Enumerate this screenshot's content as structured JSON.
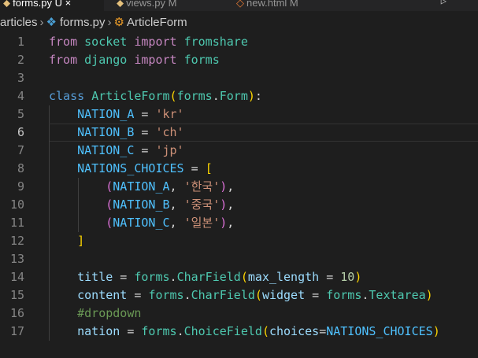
{
  "tabs": [
    {
      "label": "forms.py",
      "suffix": "  U  ×",
      "active": true
    },
    {
      "label": "views.py",
      "suffix": "  M",
      "active": false
    },
    {
      "label": "new.html",
      "suffix": "  M",
      "active": false
    }
  ],
  "breadcrumb": {
    "folder": "articles",
    "file": "forms.py",
    "symbol": "ArticleForm"
  },
  "code": {
    "line_numbers": [
      "1",
      "2",
      "3",
      "4",
      "5",
      "6",
      "7",
      "8",
      "9",
      "10",
      "11",
      "12",
      "13",
      "14",
      "15",
      "16",
      "17"
    ],
    "current_line": 6,
    "lines": [
      [
        [
          "imp",
          "from"
        ],
        [
          "op",
          " "
        ],
        [
          "mod",
          "socket"
        ],
        [
          "op",
          " "
        ],
        [
          "imp",
          "import"
        ],
        [
          "op",
          " "
        ],
        [
          "mod",
          "fromshare"
        ]
      ],
      [
        [
          "imp",
          "from"
        ],
        [
          "op",
          " "
        ],
        [
          "mod",
          "django"
        ],
        [
          "op",
          " "
        ],
        [
          "imp",
          "import"
        ],
        [
          "op",
          " "
        ],
        [
          "mod",
          "forms"
        ]
      ],
      [],
      [
        [
          "kw",
          "class"
        ],
        [
          "op",
          " "
        ],
        [
          "mod",
          "ArticleForm"
        ],
        [
          "p1",
          "("
        ],
        [
          "mod",
          "forms"
        ],
        [
          "op",
          "."
        ],
        [
          "mod",
          "Form"
        ],
        [
          "p1",
          ")"
        ],
        [
          "op",
          ":"
        ]
      ],
      [
        [
          "op",
          "    "
        ],
        [
          "const",
          "NATION_A"
        ],
        [
          "op",
          " = "
        ],
        [
          "str",
          "'kr'"
        ]
      ],
      [
        [
          "op",
          "    "
        ],
        [
          "const",
          "NATION_B"
        ],
        [
          "op",
          " = "
        ],
        [
          "str",
          "'ch'"
        ]
      ],
      [
        [
          "op",
          "    "
        ],
        [
          "const",
          "NATION_C"
        ],
        [
          "op",
          " = "
        ],
        [
          "str",
          "'jp'"
        ]
      ],
      [
        [
          "op",
          "    "
        ],
        [
          "const",
          "NATIONS_CHOICES"
        ],
        [
          "op",
          " = "
        ],
        [
          "p1",
          "["
        ]
      ],
      [
        [
          "op",
          "        "
        ],
        [
          "p2",
          "("
        ],
        [
          "const",
          "NATION_A"
        ],
        [
          "op",
          ", "
        ],
        [
          "str",
          "'한국'"
        ],
        [
          "p2",
          ")"
        ],
        [
          "op",
          ","
        ]
      ],
      [
        [
          "op",
          "        "
        ],
        [
          "p2",
          "("
        ],
        [
          "const",
          "NATION_B"
        ],
        [
          "op",
          ", "
        ],
        [
          "str",
          "'중국'"
        ],
        [
          "p2",
          ")"
        ],
        [
          "op",
          ","
        ]
      ],
      [
        [
          "op",
          "        "
        ],
        [
          "p2",
          "("
        ],
        [
          "const",
          "NATION_C"
        ],
        [
          "op",
          ", "
        ],
        [
          "str",
          "'일본'"
        ],
        [
          "p2",
          ")"
        ],
        [
          "op",
          ","
        ]
      ],
      [
        [
          "op",
          "    "
        ],
        [
          "p1",
          "]"
        ]
      ],
      [],
      [
        [
          "op",
          "    "
        ],
        [
          "var",
          "title"
        ],
        [
          "op",
          " = "
        ],
        [
          "mod",
          "forms"
        ],
        [
          "op",
          "."
        ],
        [
          "mod",
          "CharField"
        ],
        [
          "p1",
          "("
        ],
        [
          "var",
          "max_length"
        ],
        [
          "op",
          " = "
        ],
        [
          "num",
          "10"
        ],
        [
          "p1",
          ")"
        ]
      ],
      [
        [
          "op",
          "    "
        ],
        [
          "var",
          "content"
        ],
        [
          "op",
          " = "
        ],
        [
          "mod",
          "forms"
        ],
        [
          "op",
          "."
        ],
        [
          "mod",
          "CharField"
        ],
        [
          "p1",
          "("
        ],
        [
          "var",
          "widget"
        ],
        [
          "op",
          " = "
        ],
        [
          "mod",
          "forms"
        ],
        [
          "op",
          "."
        ],
        [
          "mod",
          "Textarea"
        ],
        [
          "p1",
          ")"
        ]
      ],
      [
        [
          "op",
          "    "
        ],
        [
          "cmt",
          "#dropdown"
        ]
      ],
      [
        [
          "op",
          "    "
        ],
        [
          "var",
          "nation"
        ],
        [
          "op",
          " = "
        ],
        [
          "mod",
          "forms"
        ],
        [
          "op",
          "."
        ],
        [
          "mod",
          "ChoiceField"
        ],
        [
          "p1",
          "("
        ],
        [
          "var",
          "choices"
        ],
        [
          "op",
          "="
        ],
        [
          "const",
          "NATIONS_CHOICES"
        ],
        [
          "p1",
          ")"
        ]
      ]
    ]
  }
}
